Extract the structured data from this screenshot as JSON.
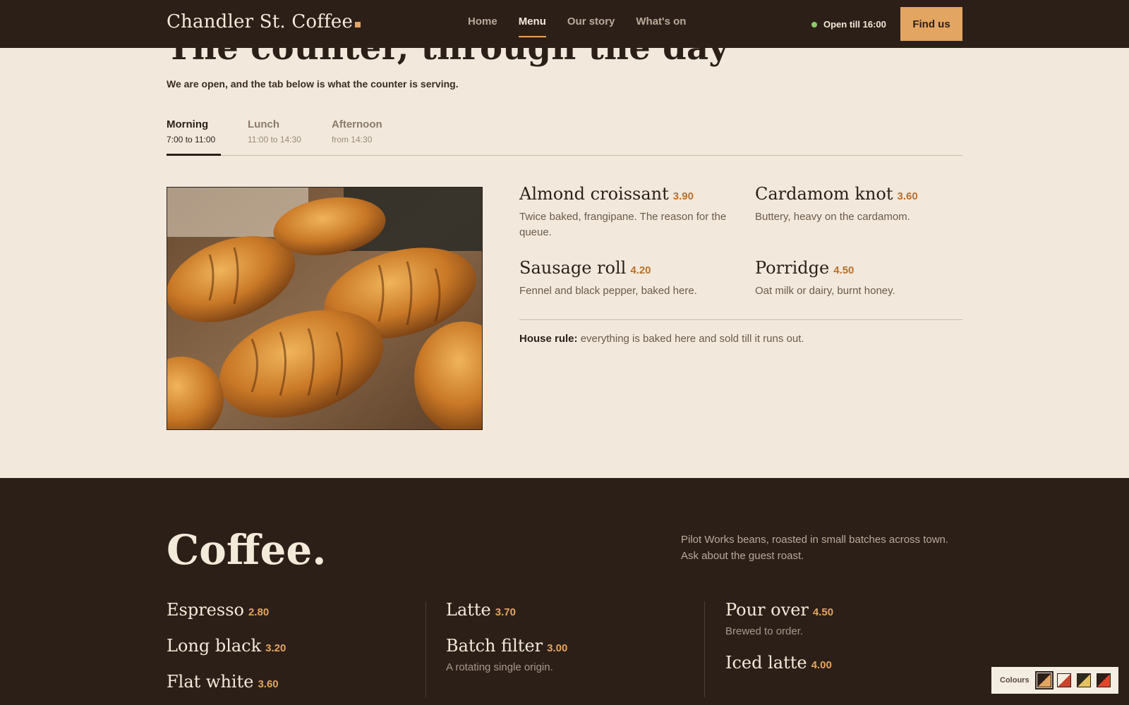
{
  "header": {
    "brand": "Chandler St. Coffee",
    "nav": [
      "Home",
      "Menu",
      "Our story",
      "What's on"
    ],
    "active_nav": "Menu",
    "status": "Open till 16:00",
    "cta": "Find us"
  },
  "hero": {
    "headline": "The counter, through the day",
    "lede": "We are open, and the tab below is what the counter is serving."
  },
  "tabs": [
    {
      "label": "Morning",
      "time": "7:00 to 11:00"
    },
    {
      "label": "Lunch",
      "time": "11:00 to 14:30"
    },
    {
      "label": "Afternoon",
      "time": "from 14:30"
    }
  ],
  "active_tab": "Morning",
  "menu": [
    {
      "name": "Almond croissant",
      "price": "3.90",
      "desc": "Twice baked, frangipane. The reason for the queue."
    },
    {
      "name": "Cardamom knot",
      "price": "3.60",
      "desc": "Buttery, heavy on the cardamom."
    },
    {
      "name": "Sausage roll",
      "price": "4.20",
      "desc": "Fennel and black pepper, baked here."
    },
    {
      "name": "Porridge",
      "price": "4.50",
      "desc": "Oat milk or dairy, burnt honey."
    }
  ],
  "house_rule": {
    "label": "House rule:",
    "text": "everything is baked here and sold till it runs out."
  },
  "coffee": {
    "title": "Coffee.",
    "intro": "Pilot Works beans, roasted in small batches across town. Ask about the guest roast.",
    "items": [
      {
        "name": "Espresso",
        "price": "2.80",
        "desc": ""
      },
      {
        "name": "Long black",
        "price": "3.20",
        "desc": ""
      },
      {
        "name": "Flat white",
        "price": "3.60",
        "desc": ""
      },
      {
        "name": "Latte",
        "price": "3.70",
        "desc": ""
      },
      {
        "name": "Batch filter",
        "price": "3.00",
        "desc": "A rotating single origin."
      },
      {
        "name": "Pour over",
        "price": "4.50",
        "desc": "Brewed to order."
      },
      {
        "name": "Iced latte",
        "price": "4.00",
        "desc": ""
      }
    ]
  },
  "swatches": {
    "label": "Colours",
    "options": [
      {
        "a": "#2c1f18",
        "b": "#e3a562"
      },
      {
        "a": "#f4ede1",
        "b": "#c8452e"
      },
      {
        "a": "#2c2c1c",
        "b": "#e3c062"
      },
      {
        "a": "#2c1f18",
        "b": "#e0482e"
      }
    ],
    "selected": 0
  },
  "colors": {
    "dark": "#2c1f18",
    "cream": "#f2e9dc",
    "accent": "#e3a562",
    "price_light_bg": "#b9702d",
    "open_dot": "#8cc96b"
  }
}
